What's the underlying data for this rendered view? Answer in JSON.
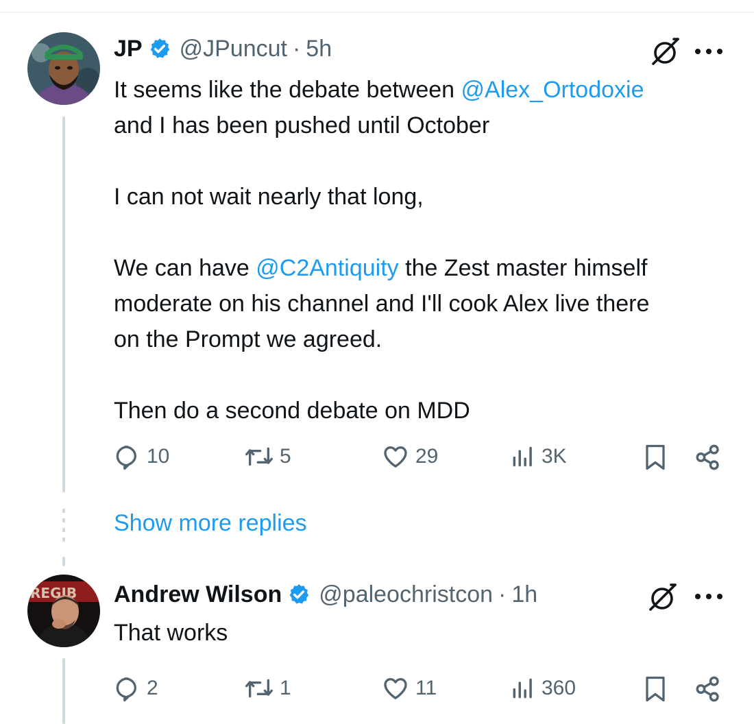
{
  "tweets": [
    {
      "display_name": "JP",
      "handle": "@JPuncut",
      "separator": "·",
      "time": "5h",
      "lines": [
        [
          {
            "t": "It seems like the debate between "
          },
          {
            "t": "@Alex_Ortodoxie",
            "m": true
          }
        ],
        [
          {
            "t": "and I has been pushed until October"
          }
        ],
        [
          {
            "t": ""
          }
        ],
        [
          {
            "t": "I can not wait nearly that long,"
          }
        ],
        [
          {
            "t": ""
          }
        ],
        [
          {
            "t": "We can have "
          },
          {
            "t": "@C2Antiquity",
            "m": true
          },
          {
            "t": " the Zest master himself"
          }
        ],
        [
          {
            "t": "moderate on his channel and I'll cook Alex live there"
          }
        ],
        [
          {
            "t": "on the Prompt we agreed."
          }
        ],
        [
          {
            "t": ""
          }
        ],
        [
          {
            "t": "Then do a second debate on MDD"
          }
        ]
      ],
      "actions": {
        "replies": "10",
        "reposts": "5",
        "likes": "29",
        "views": "3K"
      }
    },
    {
      "display_name": "Andrew Wilson",
      "handle": "@paleochristcon",
      "separator": "·",
      "time": "1h",
      "lines": [
        [
          {
            "t": "That works"
          }
        ]
      ],
      "actions": {
        "replies": "2",
        "reposts": "1",
        "likes": "11",
        "views": "360"
      }
    }
  ],
  "show_more_replies": "Show more replies",
  "icons": {
    "verified": "verified-badge-icon",
    "grok": "grok-icon",
    "more": "more-icon",
    "reply": "reply-icon",
    "repost": "repost-icon",
    "like": "like-icon",
    "views": "views-icon",
    "bookmark": "bookmark-icon",
    "share": "share-icon"
  },
  "colors": {
    "link": "#1d9bf0",
    "text": "#0f1419",
    "secondary": "#536471",
    "thread_line": "#cfd9de"
  }
}
